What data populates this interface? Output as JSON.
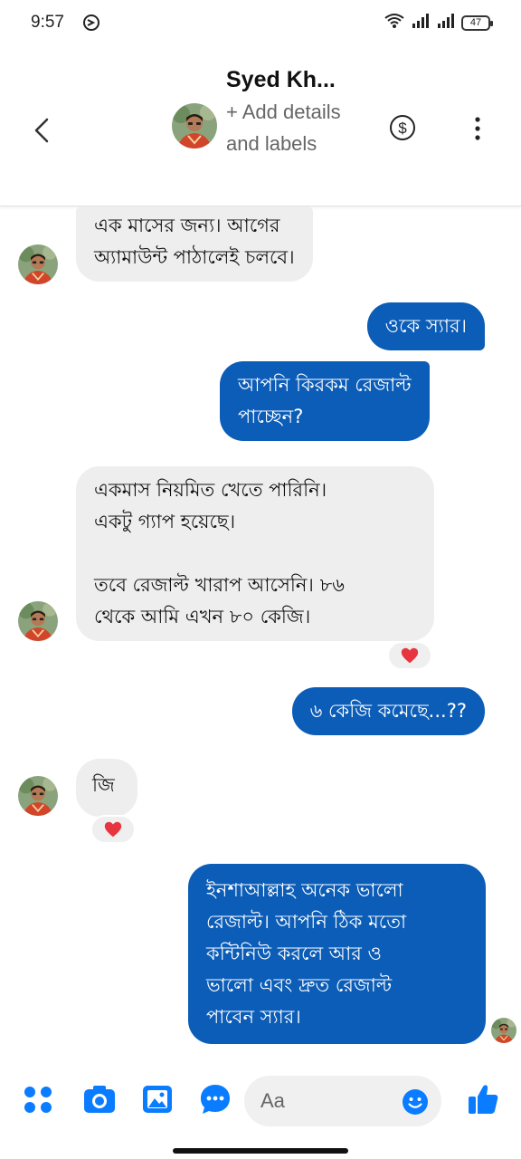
{
  "status": {
    "time": "9:57",
    "battery": "47"
  },
  "header": {
    "contact_name": "Syed Kh...",
    "subtitle": "+ Add details and labels"
  },
  "messages": [
    {
      "direction": "incoming",
      "text": "এক মাসের জন্য। আগের\nঅ্যামাউন্ট পাঠালেই চলবে।"
    },
    {
      "direction": "outgoing",
      "text": "ওকে স্যার।"
    },
    {
      "direction": "outgoing",
      "text": "আপনি কিরকম রেজাল্ট\nপাচ্ছেন?"
    },
    {
      "direction": "incoming",
      "text": "একমাস নিয়মিত খেতে পারিনি।\nএকটু গ্যাপ হয়েছে।\n\nতবে রেজাল্ট খারাপ আসেনি। ৮৬\nথেকে আমি এখন ৮০ কেজি।",
      "reaction": "heart"
    },
    {
      "direction": "outgoing",
      "text": "৬ কেজি কমেছে...??"
    },
    {
      "direction": "incoming",
      "text": "জি",
      "reaction": "heart"
    },
    {
      "direction": "outgoing",
      "text": "ইনশাআল্লাহ অনেক ভালো\nরেজাল্ট। আপনি ঠিক মতো\nকন্টিনিউ করলে আর ও\nভালো এবং দ্রুত রেজাল্ট\nপাবেন স্যার।"
    }
  ],
  "composer": {
    "placeholder": "Aa",
    "icons": [
      "apps-icon",
      "camera-icon",
      "gallery-icon",
      "chat-bubble-icon",
      "emoji-icon",
      "thumbs-up-icon"
    ]
  },
  "colors": {
    "accent": "#0a7cff",
    "outgoing_bubble": "#0c5db7",
    "incoming_bubble": "#eeeeee",
    "heart": "#e8343f"
  }
}
